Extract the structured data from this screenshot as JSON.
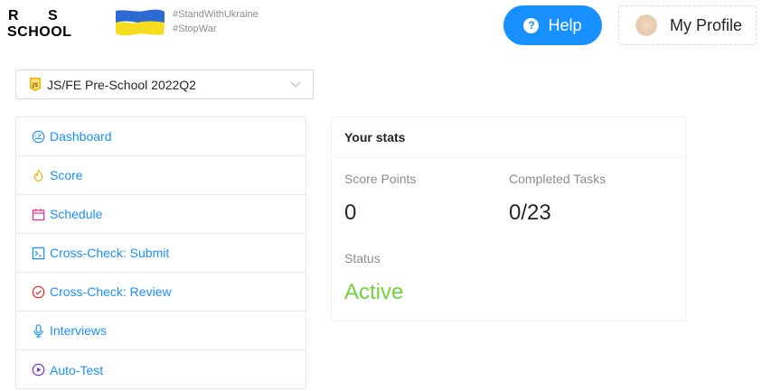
{
  "header": {
    "logo_line1_r": "R",
    "logo_line1_s": "S",
    "logo_line2": "SCHOOL",
    "hashtags": [
      "#StandWithUkraine",
      "#StopWar"
    ],
    "flag_colors": {
      "top": "#2d6ad2",
      "bottom": "#f7dc1e"
    },
    "help_label": "Help",
    "help_icon": "question-circle-icon",
    "profile_label": "My Profile"
  },
  "course_select": {
    "icon": "javascript-icon",
    "selected": "JS/FE Pre-School 2022Q2"
  },
  "nav": {
    "items": [
      {
        "label": "Dashboard",
        "icon": "dashboard-icon",
        "color": "#1890ff"
      },
      {
        "label": "Score",
        "icon": "fire-icon",
        "color": "#faad14"
      },
      {
        "label": "Schedule",
        "icon": "calendar-icon",
        "color": "#eb2f96"
      },
      {
        "label": "Cross-Check: Submit",
        "icon": "code-icon",
        "color": "#1890ff"
      },
      {
        "label": "Cross-Check: Review",
        "icon": "check-circle-icon",
        "color": "#f5222d"
      },
      {
        "label": "Interviews",
        "icon": "audio-icon",
        "color": "#1890ff"
      },
      {
        "label": "Auto-Test",
        "icon": "play-circle-icon",
        "color": "#722ed1"
      }
    ]
  },
  "stats": {
    "title": "Your stats",
    "score_points_label": "Score Points",
    "score_points_value": "0",
    "completed_tasks_label": "Completed Tasks",
    "completed_tasks_value": "0/23",
    "status_label": "Status",
    "status_value": "Active",
    "status_color": "#73d13d"
  }
}
